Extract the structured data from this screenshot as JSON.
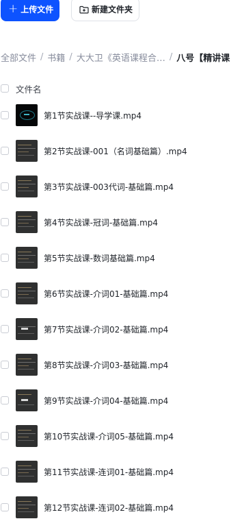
{
  "toolbar": {
    "upload_label": "上传文件",
    "new_folder_label": "新建文件夹",
    "accent_color": "#0d53ff"
  },
  "breadcrumb": {
    "items": [
      "全部文件",
      "书籍",
      "大大卫《英语课程合…",
      "八号【精讲课"
    ],
    "separator": "/"
  },
  "list_header": {
    "name_label": "文件名"
  },
  "files": [
    {
      "name": "第1节实战课--导学课.mp4"
    },
    {
      "name": "第2节实战课-001（名词基础篇）.mp4"
    },
    {
      "name": "第3节实战课-003代词-基础篇.mp4"
    },
    {
      "name": "第4节实战课-冠词-基础篇.mp4"
    },
    {
      "name": "第5节实战课-数词基础篇.mp4"
    },
    {
      "name": "第6节实战课-介词01-基础篇.mp4"
    },
    {
      "name": "第7节实战课-介词02-基础篇.mp4"
    },
    {
      "name": "第8节实战课-介词03-基础篇.mp4"
    },
    {
      "name": "第9节实战课-介词04-基础篇.mp4"
    },
    {
      "name": "第10节实战课-介词05-基础篇.mp4"
    },
    {
      "name": "第11节实战课-连词01-基础篇.mp4"
    },
    {
      "name": "第12节实战课-连词02-基础篇.mp4"
    }
  ]
}
